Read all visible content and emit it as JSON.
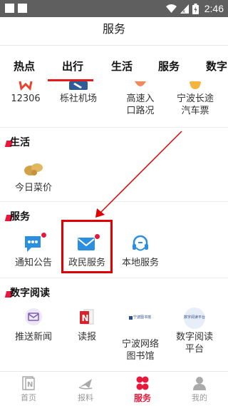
{
  "status_bar": {
    "time": "2:46"
  },
  "header": {
    "title": "服务"
  },
  "tabs": [
    "热点",
    "出行",
    "生活",
    "服务",
    "数字阅"
  ],
  "travel": {
    "items": [
      "12306",
      "栎社机场",
      "高速入口路况",
      "宁波长途汽车票"
    ]
  },
  "life": {
    "title": "生活",
    "items": [
      "今日菜价"
    ]
  },
  "services": {
    "title": "服务",
    "items": [
      "通知公告",
      "政民服务",
      "本地服务"
    ]
  },
  "reading": {
    "title": "数字阅读",
    "items": [
      "推送新闻",
      "读报",
      "宁波网络图书馆",
      "数字阅读平台"
    ],
    "icon_texts": [
      "宁波图书馆",
      "数字阅读平台"
    ]
  },
  "bottom_nav": [
    {
      "label": "首页",
      "active": false
    },
    {
      "label": "报料",
      "active": false
    },
    {
      "label": "服务",
      "active": true
    },
    {
      "label": "我的",
      "active": false
    }
  ],
  "colors": {
    "accent": "#e8183d",
    "annotation": "#e10000",
    "icon_blue": "#2a8fe0"
  }
}
